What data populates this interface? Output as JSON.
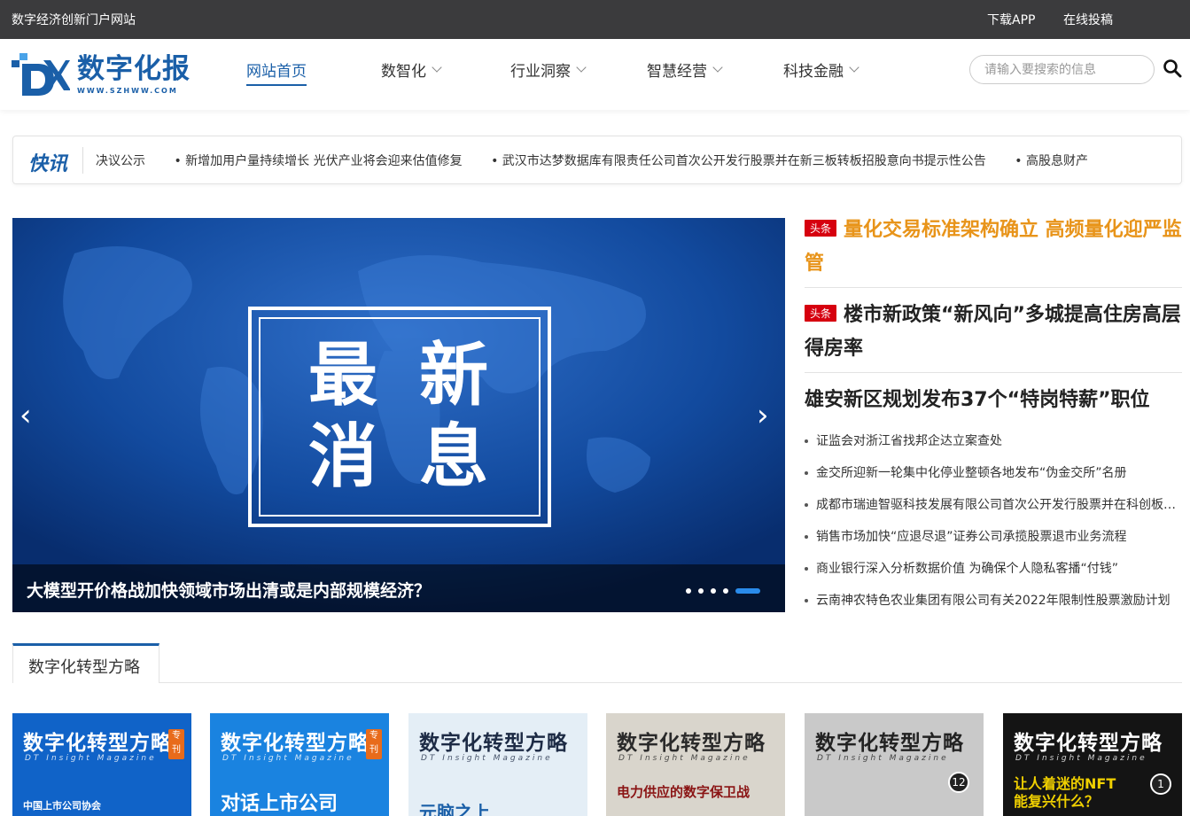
{
  "topbar": {
    "site_name": "数字经济创新门户网站",
    "download_app": "下载APP",
    "submit": "在线投稿"
  },
  "logo": {
    "name": "数字化报",
    "url": "WWW.SZHWW.COM"
  },
  "nav": [
    {
      "label": "网站首页",
      "active": true,
      "dropdown": false
    },
    {
      "label": "数智化",
      "active": false,
      "dropdown": true
    },
    {
      "label": "行业洞察",
      "active": false,
      "dropdown": true
    },
    {
      "label": "智慧经营",
      "active": false,
      "dropdown": true
    },
    {
      "label": "科技金融",
      "active": false,
      "dropdown": true
    }
  ],
  "search": {
    "placeholder": "请输入要搜索的信息",
    "icon": "search-icon"
  },
  "ticker": {
    "label": "快讯",
    "items": [
      "决议公示",
      "• 新增加用户量持续增长 光伏产业将会迎来估值修复",
      "• 武汉市达梦数据库有限责任公司首次公开发行股票并在新三板转板招股意向书提示性公告",
      "• 高股息财产"
    ]
  },
  "slider": {
    "image_text_line1": "最 新",
    "image_text_line2": "消 息",
    "caption": "大模型开价格战加快领域市场出清或是内部规模经济？",
    "slide_count": 5,
    "active_slide": 5,
    "prev": "‹",
    "next": "›"
  },
  "headlines": [
    {
      "tag": "头条",
      "title": "量化交易标准架构确立 高频量化迎严监管",
      "color": "#e8941a"
    },
    {
      "tag": "头条",
      "title": "楼市新政策“新风向”多城提高住房高层得房率",
      "color": "#222222"
    },
    {
      "tag": "",
      "title": "雄安新区规划发布37个“特岗特薪”职位",
      "color": "#222222"
    }
  ],
  "news_list": [
    "证监会对浙江省找邦企达立案查处",
    "金交所迎新一轮集中化停业整顿各地发布“伪金交所”名册",
    "成都市瑞迪智驱科技发展有限公司首次公开发行股票并在科创板上市",
    "销售市场加快“应退尽退”证券公司承揽股票退市业务流程",
    "商业银行深入分析数据价值 为确保个人隐私客播“付钱”",
    "云南神农特色农业集团有限公司有关2022年限制性股票激励计划"
  ],
  "section": {
    "tab_label": "数字化转型方略"
  },
  "magazines": [
    {
      "title": "数字化转型方略",
      "subtitle": "DT Insight Magazine",
      "badge": "专刊",
      "line": "中国上市公司协会",
      "bg": "#1063c8",
      "fg": "#ffffff"
    },
    {
      "title": "数字化转型方略",
      "subtitle": "DT Insight Magazine",
      "badge": "专刊",
      "line": "对话上市公司",
      "bg": "#1a83e0",
      "fg": "#ffffff"
    },
    {
      "title": "数字化转型方略",
      "subtitle": "DT Insight Magazine",
      "badge": "",
      "line": "元脑之上",
      "bg": "#e4eef6",
      "fg": "#1d2b45"
    },
    {
      "title": "数字化转型方略",
      "subtitle": "DT Insight Magazine",
      "badge": "",
      "line": "电力供应的数字保卫战",
      "bg": "#d9d5cc",
      "fg": "#2a2a2a"
    },
    {
      "title": "数字化转型方略",
      "subtitle": "DT Insight Magazine",
      "badge": "12",
      "line": "",
      "bg": "#c9c9c9",
      "fg": "#222222"
    },
    {
      "title": "数字化转型方略",
      "subtitle": "DT Insight Magazine",
      "badge": "1",
      "line": "让人着迷的NFT能复兴什么？",
      "bg": "#141414",
      "fg": "#ffffff"
    }
  ]
}
